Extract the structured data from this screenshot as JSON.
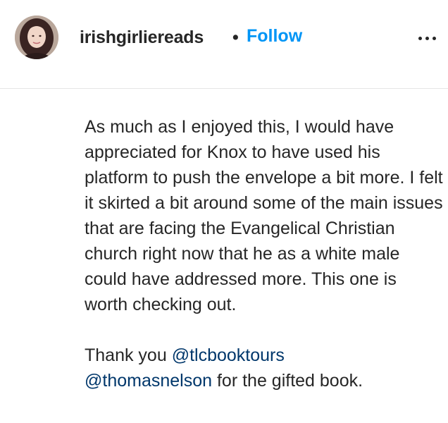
{
  "post_header": {
    "username": "irishgirliereads",
    "separator": "•",
    "follow_label": "Follow",
    "more_icon": "more-horizontal-icon"
  },
  "caption": {
    "review_text": "As much as I enjoyed this, I would have appreciated for Knox to have used his platform to push the envelope a bit more. I felt it skirted a bit around some of the main issues that are facing the Evangelical Christian church right now that he as a white male could have addressed more. This one is worth checking out.",
    "thanks_prefix": "Thank you ",
    "mention_1": "@tlcbooktours",
    "mention_2": "@thomasnelson",
    "thanks_suffix": " for the gifted book."
  },
  "colors": {
    "follow_blue": "#0095f6",
    "mention_blue": "#00376b",
    "text": "#262626",
    "divider": "#e6e6e6"
  }
}
